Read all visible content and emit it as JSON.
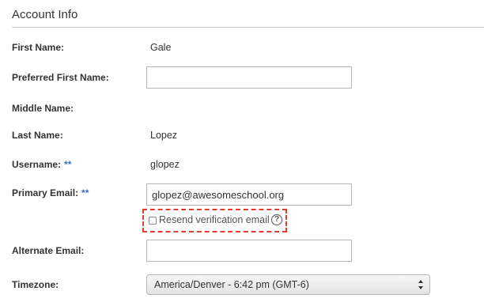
{
  "section": {
    "title": "Account Info"
  },
  "required_marker": "**",
  "fields": {
    "first_name": {
      "label": "First Name:",
      "value": "Gale"
    },
    "preferred_first_name": {
      "label": "Preferred First Name:",
      "value": ""
    },
    "middle_name": {
      "label": "Middle Name:",
      "value": ""
    },
    "last_name": {
      "label": "Last Name:",
      "value": "Lopez"
    },
    "username": {
      "label": "Username:",
      "value": "glopez"
    },
    "primary_email": {
      "label": "Primary Email:",
      "value": "glopez@awesomeschool.org"
    },
    "alternate_email": {
      "label": "Alternate Email:",
      "value": ""
    },
    "timezone": {
      "label": "Timezone:",
      "value": "America/Denver - 6:42 pm (GMT-6)"
    }
  },
  "resend": {
    "label": "Resend verification email",
    "checked": false,
    "help_icon_glyph": "?"
  },
  "colors": {
    "highlight_border": "#e53b2c",
    "required_marker": "#3b6fc4"
  }
}
